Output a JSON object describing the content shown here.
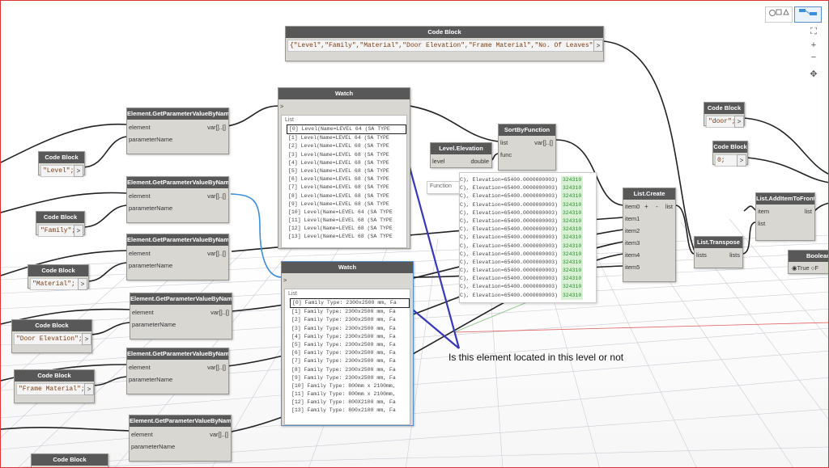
{
  "colors": {
    "node_header": "#585858",
    "node_body": "#d9d7d2",
    "wire": "#222222",
    "wire_selected": "#3a8fd8",
    "annotation_line": "#3838b8",
    "id_badge_bg": "#d9f2d6",
    "code_text": "#7a3b12"
  },
  "nodes": {
    "code_block_top": {
      "title": "Code Block",
      "code": "{\"Level\",\"Family\",\"Material\",\"Door Elevation\",\"Frame Material\",\"No. Of Leaves\"};",
      "arrow": ">"
    },
    "get_param_1": {
      "title": "Element.GetParameterValueByName",
      "in1": "element",
      "in2": "parameterName",
      "out": "var[]..[]"
    },
    "get_param_2": {
      "title": "Element.GetParameterValueByName",
      "in1": "element",
      "in2": "parameterName",
      "out": "var[]..[]"
    },
    "get_param_3": {
      "title": "Element.GetParameterValueByName",
      "in1": "element",
      "in2": "parameterName",
      "out": "var[]..[]"
    },
    "get_param_4": {
      "title": "Element.GetParameterValueByName",
      "in1": "element",
      "in2": "parameterName",
      "out": "var[]..[]"
    },
    "get_param_5": {
      "title": "Element.GetParameterValueByName",
      "in1": "element",
      "in2": "parameterName",
      "out": "var[]..[]"
    },
    "get_param_6": {
      "title": "Element.GetParameterValueByName",
      "in1": "element",
      "in2": "parameterName",
      "out": "var[]..[]"
    },
    "cb_level": {
      "title": "Code Block",
      "code": "\"Level\";",
      "arrow": ">"
    },
    "cb_family": {
      "title": "Code Block",
      "code": "\"Family\";",
      "arrow": ">"
    },
    "cb_material": {
      "title": "Code Block",
      "code": "\"Material\";",
      "arrow": ">"
    },
    "cb_door_elev": {
      "title": "Code Block",
      "code": "\"Door Elevation\";",
      "arrow": ">"
    },
    "cb_frame_mat": {
      "title": "Code Block",
      "code": "\"Frame Material\";",
      "arrow": ">"
    },
    "cb_bottom": {
      "title": "Code Block"
    },
    "cb_door": {
      "title": "Code Block",
      "code": "\"door\";",
      "arrow": ">"
    },
    "cb_zero": {
      "title": "Code Block",
      "code": "0;",
      "arrow": ">"
    },
    "watch1": {
      "title": "Watch",
      "in": ">",
      "list_label": "List",
      "items": [
        "[0] Level(Name=LEVEL 64 (SA TYPE",
        "[1] Level(Name=LEVEL 64 (SA TYPE",
        "[2] Level(Name=LEVEL 68 (SA TYPE",
        "[3] Level(Name=LEVEL 68 (SA TYPE",
        "[4] Level(Name=LEVEL 68 (SA TYPE",
        "[5] Level(Name=LEVEL 68 (SA TYPE",
        "[6] Level(Name=LEVEL 68 (SA TYPE",
        "[7] Level(Name=LEVEL 68 (SA TYPE",
        "[8] Level(Name=LEVEL 68 (SA TYPE",
        "[9] Level(Name=LEVEL 68 (SA TYPE",
        "[10] Level(Name=LEVEL 64 (SA TYPE",
        "[11] Level(Name=LEVEL 68 (SA TYPE",
        "[12] Level(Name=LEVEL 68 (SA TYPE",
        "[13] Level(Name=LEVEL 68 (SA TYPE"
      ]
    },
    "watch2": {
      "title": "Watch",
      "in": ">",
      "list_label": "List",
      "items": [
        "[0] Family Type: 2300x2500 mm, Fa",
        "[1] Family Type: 2300x2500 mm, Fa",
        "[2] Family Type: 2300x2500 mm, Fa",
        "[3] Family Type: 2300x2500 mm, Fa",
        "[4] Family Type: 2300x2500 mm, Fa",
        "[5] Family Type: 2300x2500 mm, Fa",
        "[6] Family Type: 2300x2500 mm, Fa",
        "[7] Family Type: 2300x2500 mm, Fa",
        "[8] Family Type: 2300x2500 mm, Fa",
        "[9] Family Type: 2300x2500 mm, Fa",
        "[10] Family Type: 800mm x 2100mm,",
        "[11] Family Type: 800mm x 2100mm,",
        "[12] Family Type: 800X2100 mm, Fa",
        "[13] Family Type: 800x2100 mm, Fa"
      ]
    },
    "level_elevation": {
      "title": "Level.Elevation",
      "in": "level",
      "out": "double"
    },
    "sort_by_function": {
      "title": "SortByFunction",
      "in1": "list",
      "in2": "func",
      "out": "var[]..[]"
    },
    "function_stub": {
      "label": "Function"
    },
    "list_create": {
      "title": "List.Create",
      "in": [
        "item0",
        "item1",
        "item2",
        "item3",
        "item4",
        "item5"
      ],
      "plus": "+",
      "minus": "-",
      "out": "list"
    },
    "list_transpose": {
      "title": "List.Transpose",
      "in": "lists",
      "out": "lists"
    },
    "list_add_front": {
      "title": "List.AddItemToFront",
      "in1": "item",
      "in2": "list",
      "out": "list"
    },
    "boolean": {
      "title": "Boolean",
      "option_true": "True",
      "option_false": "F"
    }
  },
  "tooltip": {
    "rows": [
      {
        "text": "C), Elevation=65400.0000000003)",
        "id": "324310"
      },
      {
        "text": "C), Elevation=65400.0000000003)",
        "id": "324310"
      },
      {
        "text": "C), Elevation=65400.0000000003)",
        "id": "324310"
      },
      {
        "text": "C), Elevation=65400.0000000003)",
        "id": "324310"
      },
      {
        "text": "C), Elevation=65400.0000000003)",
        "id": "324310"
      },
      {
        "text": "C), Elevation=65400.0000000003)",
        "id": "324310"
      },
      {
        "text": "C), Elevation=65400.0000000003)",
        "id": "324310"
      },
      {
        "text": "C), Elevation=65400.0000000003)",
        "id": "324310"
      },
      {
        "text": "C), Elevation=65400.0000000003)",
        "id": "324310"
      },
      {
        "text": "C), Elevation=65400.0000000003)",
        "id": "324310"
      },
      {
        "text": "C), Elevation=65400.0000000003)",
        "id": "324310"
      },
      {
        "text": "C), Elevation=65400.0000000003)",
        "id": "324310"
      },
      {
        "text": "C), Elevation=65400.0000000003)",
        "id": "324310"
      },
      {
        "text": "C), Elevation=65400.0000000003)",
        "id": "324310"
      },
      {
        "text": "C), Elevation=65400.0000000003)",
        "id": "324310"
      }
    ]
  },
  "annotation": {
    "text": "Is this element located in this level or not"
  },
  "canvas_controls": {
    "fit": "⛶",
    "zoom_in": "+",
    "zoom_out": "−",
    "pan": "✥"
  },
  "view_toggle": {
    "geometry_icon": "geometry-view-icon",
    "graph_icon": "graph-view-icon"
  }
}
